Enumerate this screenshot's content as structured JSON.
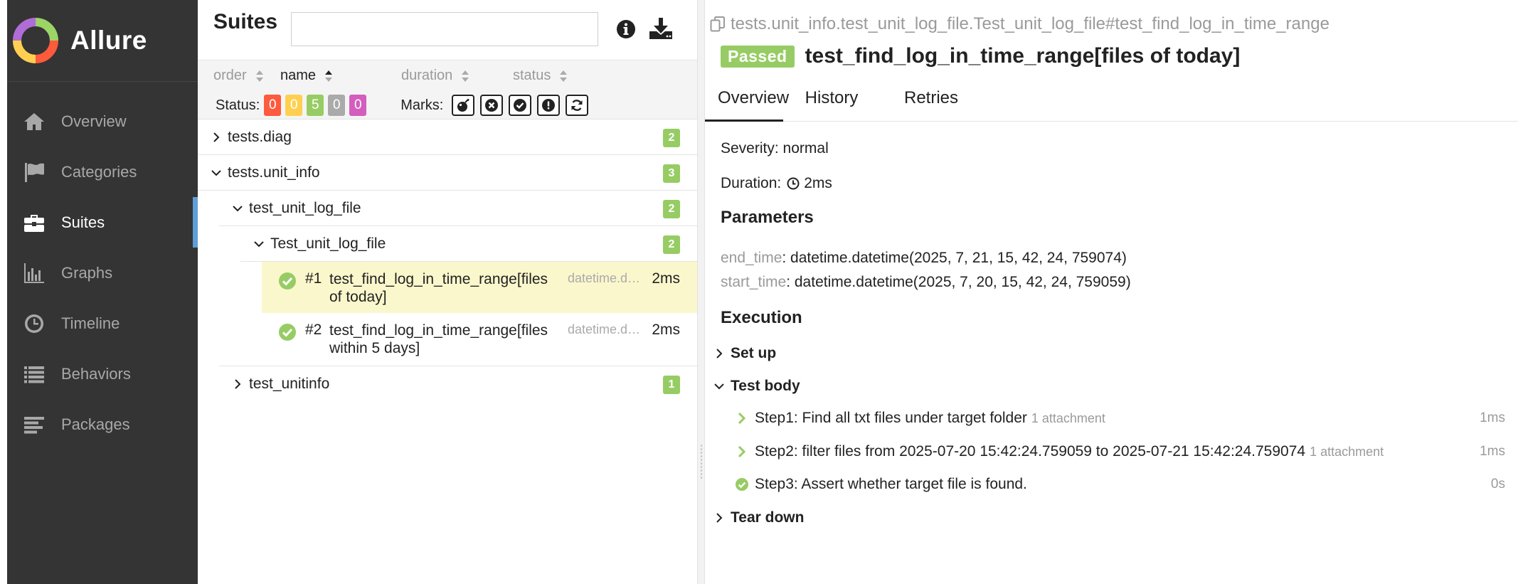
{
  "sidebar": {
    "brand": "Allure",
    "items": [
      {
        "label": "Overview",
        "icon": "home-icon"
      },
      {
        "label": "Categories",
        "icon": "flag-icon"
      },
      {
        "label": "Suites",
        "icon": "briefcase-icon",
        "active": true
      },
      {
        "label": "Graphs",
        "icon": "bar-chart-icon"
      },
      {
        "label": "Timeline",
        "icon": "clock-icon"
      },
      {
        "label": "Behaviors",
        "icon": "list-icon"
      },
      {
        "label": "Packages",
        "icon": "align-left-icon"
      }
    ],
    "colors": {
      "background": "#343434",
      "active_indicator": "#5f9ed6"
    }
  },
  "suites": {
    "title": "Suites",
    "search_value": "",
    "sort": {
      "order": "order",
      "name": "name",
      "duration": "duration",
      "status": "status",
      "active": "name"
    },
    "status_label": "Status:",
    "status_counts": [
      {
        "status": "failed",
        "value": "0",
        "color": "#fd5a3e"
      },
      {
        "status": "broken",
        "value": "0",
        "color": "#ffd050"
      },
      {
        "status": "passed",
        "value": "5",
        "color": "#97cc64"
      },
      {
        "status": "skipped",
        "value": "0",
        "color": "#aaaaaa"
      },
      {
        "status": "unknown",
        "value": "0",
        "color": "#d35ebe"
      }
    ],
    "marks_label": "Marks:",
    "marks": [
      "bomb-icon",
      "times-circle-icon",
      "check-circle-icon",
      "exclamation-circle-icon",
      "refresh-icon"
    ],
    "tree": {
      "diag": {
        "label": "tests.diag",
        "count": "2",
        "expanded": false
      },
      "unit_info": {
        "label": "tests.unit_info",
        "count": "3",
        "expanded": true
      },
      "log_file": {
        "label": "test_unit_log_file",
        "count": "2",
        "expanded": true
      },
      "log_file_class": {
        "label": "Test_unit_log_file",
        "count": "2",
        "expanded": true
      },
      "tests": [
        {
          "num": "#1",
          "name_line1": "test_find_log_in_time_range[files",
          "name_line2": "of today]",
          "param": "datetime.d…",
          "duration": "2ms",
          "selected": true
        },
        {
          "num": "#2",
          "name_line1": "test_find_log_in_time_range[files",
          "name_line2": "within 5 days]",
          "param": "datetime.d…",
          "duration": "2ms",
          "selected": false
        }
      ],
      "unitinfo": {
        "label": "test_unitinfo",
        "count": "1",
        "expanded": false
      }
    }
  },
  "detail": {
    "breadcrumb": "tests.unit_info.test_unit_log_file.Test_unit_log_file#test_find_log_in_time_range",
    "status": "Passed",
    "title": "test_find_log_in_time_range[files of today]",
    "tabs": [
      "Overview",
      "History",
      "Retries"
    ],
    "active_tab": "Overview",
    "severity_label": "Severity:",
    "severity": "normal",
    "duration_label": "Duration:",
    "duration": "2ms",
    "parameters_heading": "Parameters",
    "parameters": [
      {
        "name": "end_time",
        "value": ": datetime.datetime(2025, 7, 21, 15, 42, 24, 759074)"
      },
      {
        "name": "start_time",
        "value": ": datetime.datetime(2025, 7, 20, 15, 42, 24, 759059)"
      }
    ],
    "execution_heading": "Execution",
    "setup": "Set up",
    "test_body": "Test body",
    "teardown": "Tear down",
    "steps": [
      {
        "label": "Step1: Find all txt files under target folder",
        "attachment": "1 attachment",
        "duration": "1ms",
        "icon": "chevron-right-icon"
      },
      {
        "label": "Step2: filter files from 2025-07-20 15:42:24.759059 to 2025-07-21 15:42:24.759074",
        "attachment": "1 attachment",
        "duration": "1ms",
        "icon": "chevron-right-icon"
      },
      {
        "label": "Step3: Assert whether target file is found.",
        "attachment": "",
        "duration": "0s",
        "icon": "check-circle-icon"
      }
    ],
    "colors": {
      "passed": "#97cc64"
    }
  }
}
